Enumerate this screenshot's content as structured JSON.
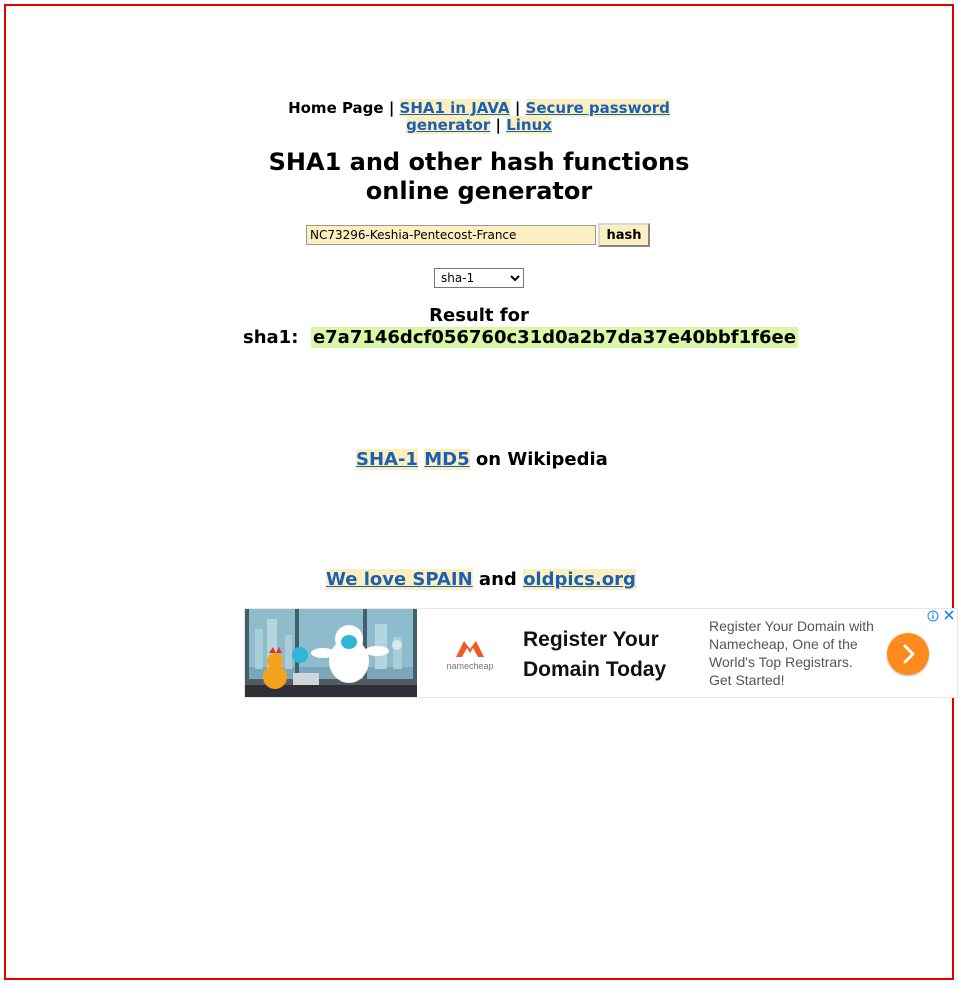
{
  "nav": {
    "home": "Home Page",
    "separator": "|",
    "java_link": "SHA1 in JAVA",
    "password_link": "Secure password generator",
    "linux_link": "Linux"
  },
  "title": {
    "line1": "SHA1 and other hash functions",
    "line2": "online generator"
  },
  "form": {
    "input_value": "NC73296-Keshia-Pentecost-France",
    "hash_button": "hash",
    "algorithm_selected": "sha-1"
  },
  "result": {
    "label": "Result for",
    "algo_label": "sha1:",
    "hash": "e7a7146dcf056760c31d0a2b7da37e40bbf1f6ee"
  },
  "wiki": {
    "sha1_link": "SHA-1",
    "md5_link": "MD5",
    "suffix": "on Wikipedia"
  },
  "links": {
    "spain": "We love SPAIN",
    "and": "and",
    "oldpics": "oldpics.org"
  },
  "ad": {
    "brand": "namecheap",
    "headline_line1": "Register Your",
    "headline_line2": "Domain Today",
    "description": "Register Your Domain with Namecheap, One of the World's Top Registrars. Get Started!",
    "info_icon": "info-icon",
    "close_icon": "close-icon",
    "cta_icon": "chevron-right-icon"
  },
  "colors": {
    "frame_border": "#e00000",
    "link": "#1a5fb4",
    "link_highlight": "#fbefc0",
    "hash_highlight": "#d9f7a6",
    "input_bg": "#fcefc1",
    "cta_orange": "#ff8a1c"
  }
}
